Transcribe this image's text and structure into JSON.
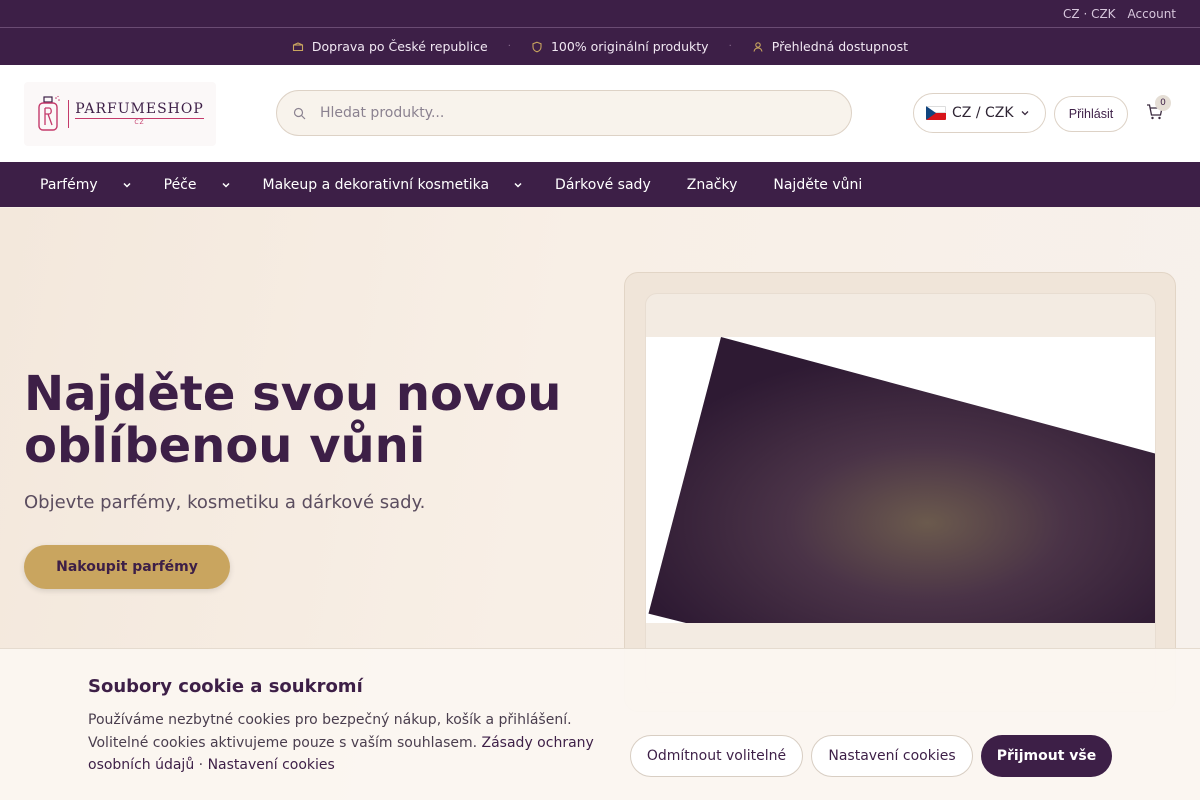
{
  "topbar": {
    "locale": "CZ · CZK",
    "account": "Account"
  },
  "promo": [
    {
      "icon": "package-icon",
      "label": "Doprava po České republice"
    },
    {
      "icon": "shield-icon",
      "label": "100% originální produkty"
    },
    {
      "icon": "user-icon",
      "label": "Přehledná dostupnost"
    }
  ],
  "header": {
    "logo_text": "PARFUMESHOP",
    "logo_sub": "CZ",
    "search_placeholder": "Hledat produkty...",
    "region_label": "CZ / CZK",
    "login_label": "Přihlásit",
    "cart_count": "0"
  },
  "nav": {
    "perfumes": "Parfémy",
    "care": "Péče",
    "makeup": "Makeup a dekorativní kosmetika",
    "gift_sets": "Dárkové sady",
    "brands": "Značky",
    "find_scent": "Najděte vůni"
  },
  "hero": {
    "title": "Najděte svou novou oblíbenou vůni",
    "subtitle": "Objevte parfémy, kosmetiku a dárkové sady.",
    "cta": "Nakoupit parfémy"
  },
  "cookie": {
    "title": "Soubory cookie a soukromí",
    "text": "Používáme nezbytné cookies pro bezpečný nákup, košík a přihlášení. Volitelné cookies aktivujeme pouze s vaším souhlasem.",
    "privacy_link": "Zásady ochrany osobních údajů",
    "separator": "·",
    "settings_link": "Nastavení cookies",
    "reject": "Odmítnout volitelné",
    "settings": "Nastavení cookies",
    "accept": "Přijmout vše"
  },
  "colors": {
    "brand": "#3d1f47",
    "accent": "#c9a55f",
    "logo_accent": "#c43a6b"
  }
}
